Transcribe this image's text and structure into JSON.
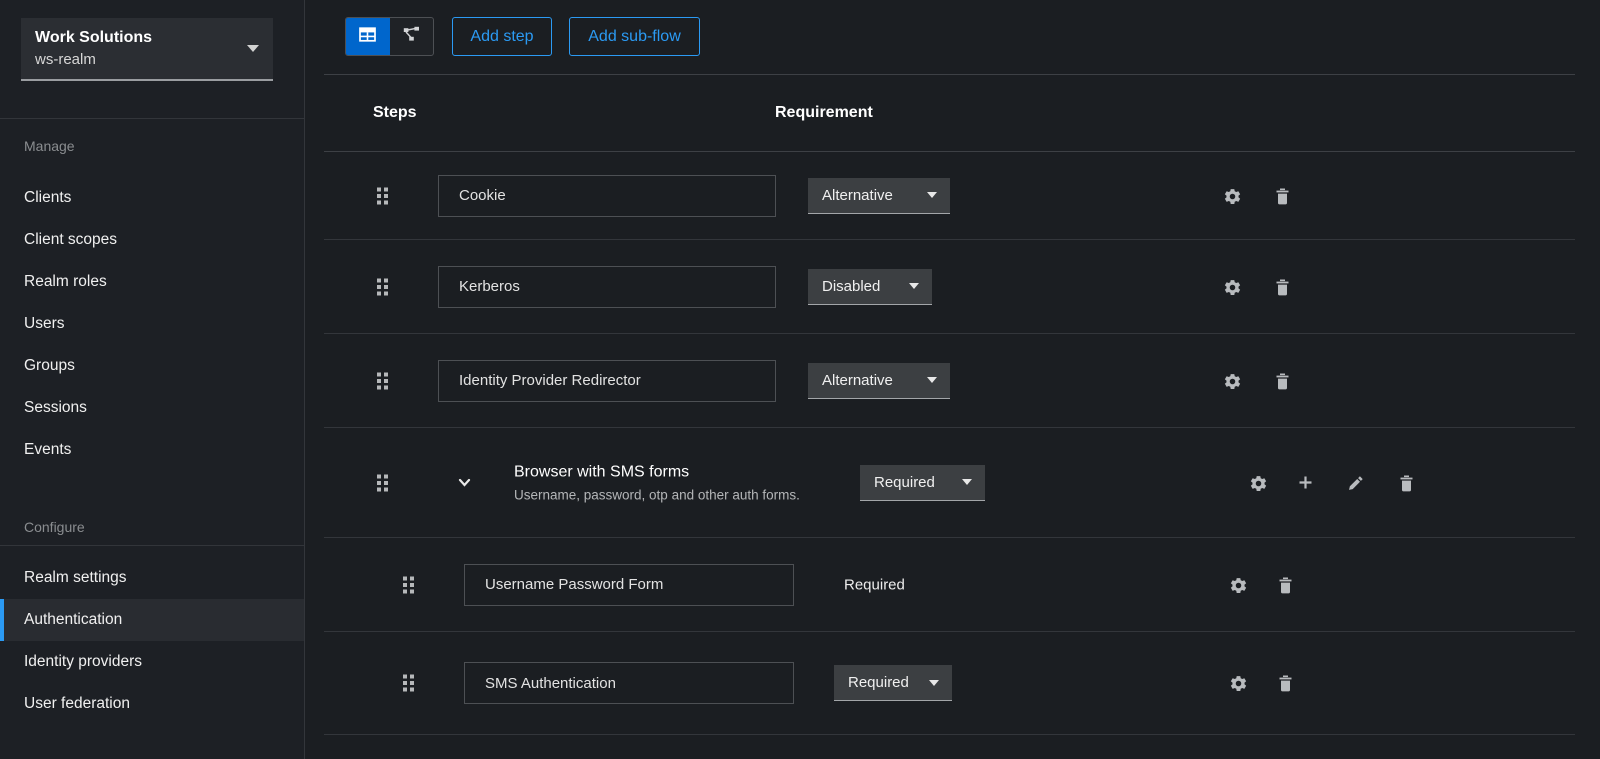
{
  "sidebar": {
    "realm_switcher": {
      "title": "Work Solutions",
      "subtitle": "ws-realm"
    },
    "groups": [
      {
        "label": "Manage",
        "items": [
          "Clients",
          "Client scopes",
          "Realm roles",
          "Users",
          "Groups",
          "Sessions",
          "Events"
        ],
        "selected": ""
      },
      {
        "label": "Configure",
        "items": [
          "Realm settings",
          "Authentication",
          "Identity providers",
          "User federation"
        ],
        "selected": "Authentication"
      }
    ]
  },
  "toolbar": {
    "view_toggle": {
      "options": [
        "table-view",
        "diagram-view"
      ],
      "selected": "table-view"
    },
    "add_step_label": "Add step",
    "add_subflow_label": "Add sub-flow"
  },
  "table": {
    "columns": [
      "Steps",
      "Requirement"
    ],
    "rows": [
      {
        "name": "Cookie",
        "requirement": "Alternative",
        "requirement_control": "select",
        "kind": "step",
        "indent": 0,
        "actions": [
          "settings",
          "delete"
        ]
      },
      {
        "name": "Kerberos",
        "requirement": "Disabled",
        "requirement_control": "select",
        "kind": "step",
        "indent": 0,
        "actions": [
          "settings",
          "delete"
        ]
      },
      {
        "name": "Identity Provider Redirector",
        "requirement": "Alternative",
        "requirement_control": "select",
        "kind": "step",
        "indent": 0,
        "actions": [
          "settings",
          "delete"
        ]
      },
      {
        "name": "Browser with SMS forms",
        "description": "Username, password, otp and other auth forms.",
        "requirement": "Required",
        "requirement_control": "select",
        "kind": "subflow",
        "indent": 0,
        "actions": [
          "settings",
          "add-step",
          "edit",
          "delete"
        ]
      },
      {
        "name": "Username Password Form",
        "requirement": "Required",
        "requirement_control": "text",
        "kind": "step",
        "indent": 1,
        "actions": [
          "settings",
          "delete"
        ]
      },
      {
        "name": "SMS Authentication",
        "requirement": "Required",
        "requirement_control": "select",
        "kind": "step",
        "indent": 1,
        "actions": [
          "settings",
          "delete"
        ]
      }
    ]
  },
  "colors": {
    "primary_blue": "#0066cc",
    "link_blue": "#2b9af3",
    "nav_selected_indicator": "#2b9af3",
    "background": "#1b1e22",
    "surface": "#2b2e33",
    "select_background": "#3c3f42"
  }
}
